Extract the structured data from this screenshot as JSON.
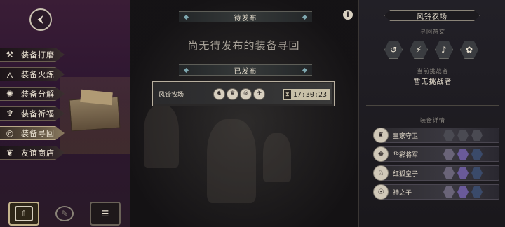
{
  "sidebar": {
    "menu": [
      {
        "label": "装备打磨",
        "icon": "hammer-icon",
        "glyph": "⚒"
      },
      {
        "label": "装备火炼",
        "icon": "flame-icon",
        "glyph": "🜂"
      },
      {
        "label": "装备分解",
        "icon": "break-icon",
        "glyph": "✺"
      },
      {
        "label": "装备祈福",
        "icon": "pray-icon",
        "glyph": "♆"
      },
      {
        "label": "装备寻回",
        "icon": "search-icon",
        "glyph": "◎"
      },
      {
        "label": "友谊商店",
        "icon": "fox-icon",
        "glyph": "❦"
      }
    ],
    "active_index": 4,
    "bottom_buttons": [
      {
        "icon": "upload-icon",
        "glyph": "⇧"
      },
      {
        "icon": "feather-icon",
        "glyph": "✎"
      },
      {
        "icon": "list-icon",
        "glyph": "☰"
      }
    ]
  },
  "center": {
    "pending_header": "待发布",
    "empty_message": "尚无待发布的装备寻回",
    "published_header": "已发布",
    "quest": {
      "name": "风铃农场",
      "avatars": [
        "♞",
        "♛",
        "☠",
        "✈"
      ],
      "timer": "17:30:23",
      "timer_icon": "hourglass-icon"
    },
    "info_glyph": "i"
  },
  "right": {
    "title": "风铃农场",
    "rune_label": "寻回符文",
    "runes": [
      "↺",
      "⚡",
      "♪",
      "✿"
    ],
    "challenger_label": "当前挑战者",
    "challenger_value": "暂无挑战者",
    "equip_label": "装备详情",
    "equipment": [
      {
        "name": "皇家守卫",
        "avatar": "♜",
        "slots": [
          "dim",
          "dim",
          "dim"
        ]
      },
      {
        "name": "华彩将军",
        "avatar": "♚",
        "slots": [
          "weapon",
          "armor",
          "acc"
        ]
      },
      {
        "name": "红狐皇子",
        "avatar": "♘",
        "slots": [
          "weapon",
          "armor",
          "acc"
        ]
      },
      {
        "name": "神之子",
        "avatar": "☉",
        "slots": [
          "weapon",
          "armor",
          "acc"
        ]
      }
    ]
  }
}
